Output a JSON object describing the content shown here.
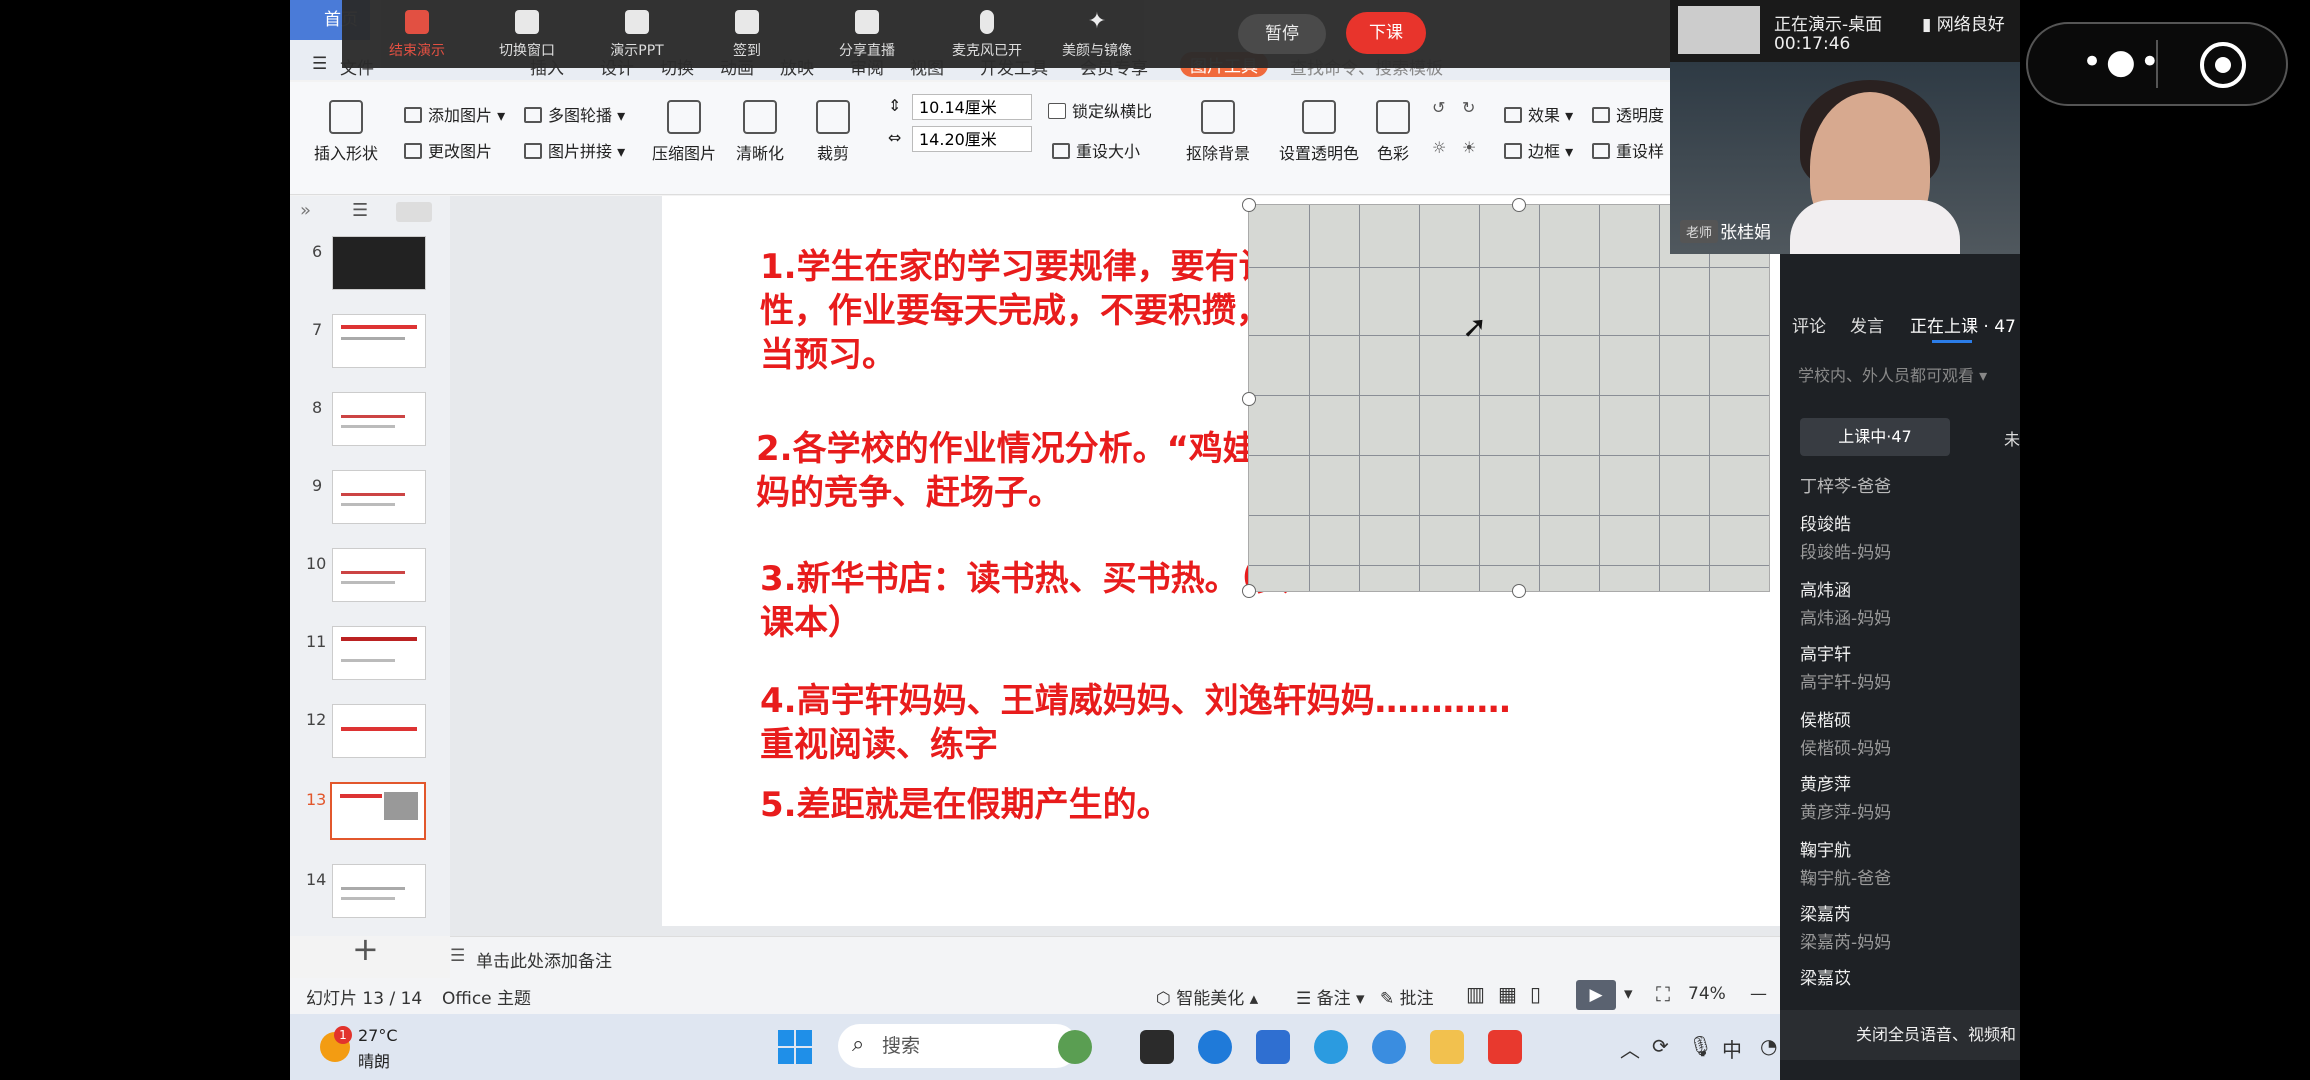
{
  "wps": {
    "home_tab": "首页",
    "file_menu": "文件",
    "menu_items": [
      "插入",
      "设计",
      "切换",
      "动画",
      "放映",
      "审阅",
      "视图",
      "开发工具",
      "会员专享",
      "图片工具",
      "查找命令、搜索模板"
    ],
    "ribbon": {
      "insert_shape": "插入形状",
      "add_picture": "添加图片",
      "change_picture": "更改图片",
      "multi_carousel": "多图轮播",
      "picture_collage": "图片拼接",
      "compress_picture": "压缩图片",
      "sharpen": "清晰化",
      "crop": "裁剪",
      "width_value": "10.14厘米",
      "height_value": "14.20厘米",
      "lock_ratio": "锁定纵横比",
      "reset_size": "重设大小",
      "remove_background": "抠除背景",
      "set_transparent": "设置透明色",
      "color": "色彩",
      "effects": "效果",
      "transparency": "透明度",
      "border": "边框",
      "reset_style": "重设样"
    },
    "slides": [
      {
        "num": "6"
      },
      {
        "num": "7"
      },
      {
        "num": "8"
      },
      {
        "num": "9"
      },
      {
        "num": "10"
      },
      {
        "num": "11"
      },
      {
        "num": "12"
      },
      {
        "num": "13"
      },
      {
        "num": "14"
      }
    ],
    "slide_content": [
      "1.学生在家的学习要规律，要有计划",
      "性，作业要每天完成，不要积攒，适",
      "当预习。",
      "2.各学校的作业情况分析。“鸡娃”妈",
      "妈的竞争、赶场子。",
      "3.新华书店：读书热、买书热。（买",
      "课本）",
      "4.高宇轩妈妈、王靖威妈妈、刘逸轩妈妈…………",
      "重视阅读、练字",
      "5.差距就是在假期产生的。"
    ],
    "notes_placeholder": "单击此处添加备注",
    "status": {
      "slide_counter": "幻灯片 13 / 14",
      "theme": "Office 主题",
      "smart_beautify": "智能美化",
      "notes": "备注",
      "comments": "批注",
      "zoom": "74%"
    }
  },
  "meeting_toolbar": {
    "buttons": [
      "结束演示",
      "切换窗口",
      "演示PPT",
      "签到",
      "分享直播",
      "麦克风已开",
      "美颜与镜像"
    ],
    "pause": "暂停",
    "end_class": "下课"
  },
  "video": {
    "status": "正在演示-桌面",
    "timer": "00:17:46",
    "network": "网络良好",
    "teacher_tag": "老师",
    "teacher_name": "张桂娟"
  },
  "side_panel": {
    "tabs": [
      "评论",
      "发言",
      "正在上课 · 47"
    ],
    "visibility": "学校内、外人员都可观看",
    "in_class": "上课中·47",
    "not_in": "未",
    "students": [
      {
        "name": "丁梓芩-爸爸",
        "sub": ""
      },
      {
        "name": "段竣皓",
        "sub": "段竣皓-妈妈"
      },
      {
        "name": "高炜涵",
        "sub": "高炜涵-妈妈"
      },
      {
        "name": "高宇轩",
        "sub": "高宇轩-妈妈"
      },
      {
        "name": "侯楷硕",
        "sub": "侯楷硕-妈妈"
      },
      {
        "name": "黄彦萍",
        "sub": "黄彦萍-妈妈"
      },
      {
        "name": "鞠宇航",
        "sub": "鞠宇航-爸爸"
      },
      {
        "name": "梁嘉芮",
        "sub": "梁嘉芮-妈妈"
      },
      {
        "name": "梁嘉苡",
        "sub": ""
      }
    ],
    "mute_all": "关闭全员语音、视频和"
  },
  "taskbar": {
    "weather_temp": "27°C",
    "weather_desc": "晴朗",
    "weather_badge": "1",
    "search": "搜索",
    "ime": "中"
  }
}
